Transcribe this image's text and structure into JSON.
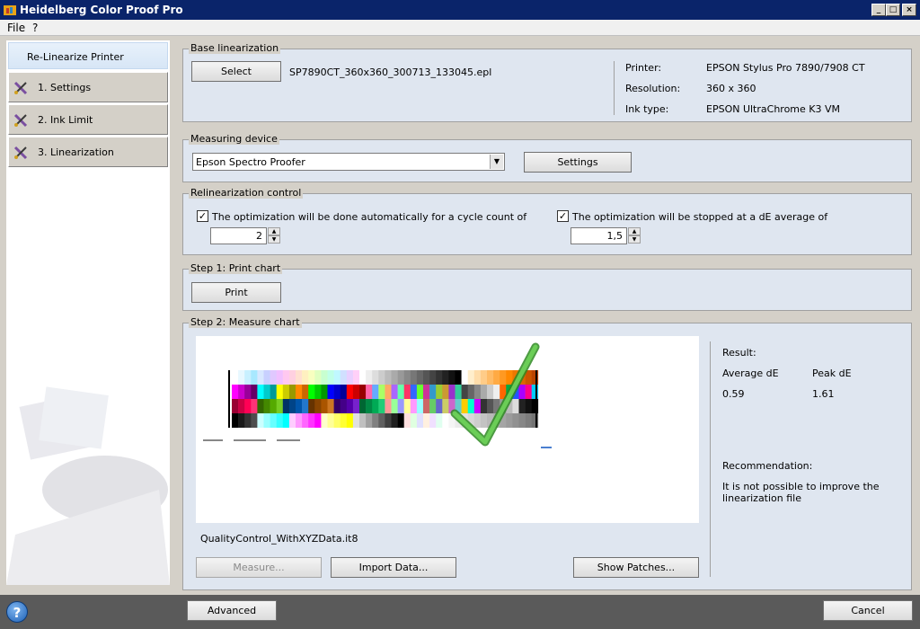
{
  "window": {
    "title": "Heidelberg Color Proof Pro",
    "controls": {
      "minimize": "_",
      "maximize": "□",
      "close": "×"
    }
  },
  "menu": {
    "items": [
      "File",
      "?"
    ]
  },
  "sidebar": {
    "header": "Re-Linearize Printer",
    "steps": [
      {
        "label": "1. Settings",
        "icon": "wrench-pen-icon"
      },
      {
        "label": "2. Ink Limit",
        "icon": "wrench-pen-icon"
      },
      {
        "label": "3. Linearization",
        "icon": "wrench-pen-icon"
      }
    ]
  },
  "base": {
    "legend": "Base linearization",
    "select_label": "Select",
    "filename": "SP7890CT_360x360_300713_133045.epl",
    "printer_label": "Printer:",
    "printer_value": "EPSON Stylus Pro 7890/7908 CT",
    "resolution_label": "Resolution:",
    "resolution_value": "360 x 360",
    "inktype_label": "Ink type:",
    "inktype_value": "EPSON UltraChrome K3 VM"
  },
  "measuring": {
    "legend": "Measuring device",
    "device": "Epson Spectro Proofer",
    "settings_label": "Settings"
  },
  "control": {
    "legend": "Relinearization control",
    "auto_label": "The optimization will be done automatically for a cycle count of",
    "auto_checked": true,
    "cycle_count": "2",
    "stop_label": "The optimization will be stopped at a dE average of",
    "stop_checked": true,
    "de_average": "1,5"
  },
  "step1": {
    "legend": "Step 1: Print chart",
    "print_label": "Print"
  },
  "step2": {
    "legend": "Step 2: Measure chart",
    "chart_file": "QualityControl_WithXYZData.it8",
    "measure_label": "Measure...",
    "import_label": "Import Data...",
    "show_patches_label": "Show Patches...",
    "result_label": "Result:",
    "avg_label": "Average dE",
    "peak_label": "Peak dE",
    "avg_value": "0.59",
    "peak_value": "1.61",
    "recommendation_label": "Recommendation:",
    "recommendation_text": "It is not possible to improve the linearization file"
  },
  "footer": {
    "help": "?",
    "advanced_label": "Advanced",
    "cancel_label": "Cancel"
  },
  "colors": {
    "titlebar": "#0a246a",
    "panel": "#dfe6f0",
    "checkmark": "#4fb83a"
  }
}
